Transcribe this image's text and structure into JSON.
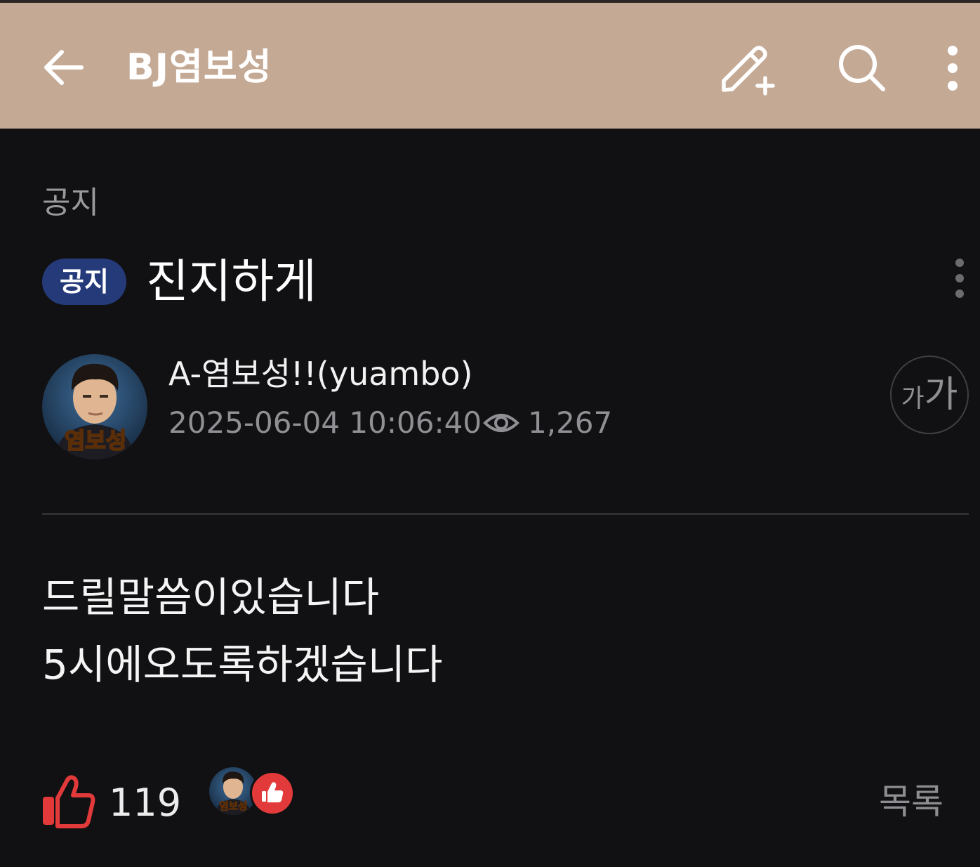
{
  "header": {
    "back_icon": "arrow-left-icon",
    "title": "BJ염보성",
    "write_icon": "pencil-plus-icon",
    "search_icon": "search-icon",
    "more_icon": "more-vertical-icon",
    "background_color": "#c4a995"
  },
  "post": {
    "category": "공지",
    "badge": "공지",
    "badge_color": "#243a79",
    "title": "진지하게",
    "author": "A-염보성!!(yuambo)",
    "datetime": "2025-06-04 10:06:40",
    "views": "1,267",
    "font_size_button": {
      "small": "가",
      "large": "가"
    },
    "avatar_caption": "염보성",
    "body": [
      "드릴말씀이있습니다",
      "5시에오도록하겠습니다"
    ]
  },
  "footer": {
    "like_count": "119",
    "like_color": "#e23a3a",
    "avatar_caption": "염보성",
    "list_label": "목록"
  }
}
